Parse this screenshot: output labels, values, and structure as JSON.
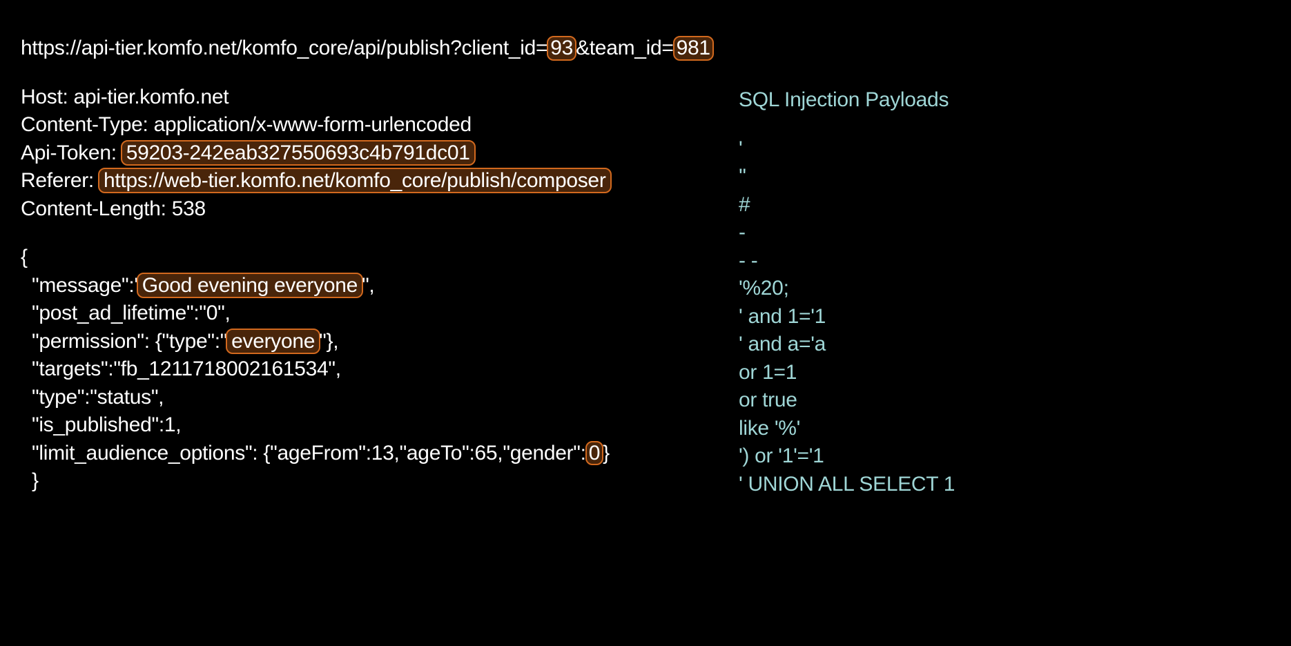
{
  "url": {
    "pre_client_id": "https://api-tier.komfo.net/komfo_core/api/publish?client_id=",
    "client_id": "93",
    "mid": "&team_id=",
    "team_id": "981"
  },
  "headers": {
    "host": "Host: api-tier.komfo.net",
    "content_type": "Content-Type: application/x-www-form-urlencoded",
    "api_token_label": "Api-Token: ",
    "api_token_value": "59203-242eab327550693c4b791dc01",
    "referer_label": "Referer: ",
    "referer_value": "https://web-tier.komfo.net/komfo_core/publish/composer",
    "content_length": "Content-Length: 538"
  },
  "body": {
    "open": "{",
    "message_pre": " \"message\":'",
    "message_val": "Good evening everyone",
    "message_post": "\",",
    "post_ad_lifetime": " \"post_ad_lifetime\":\"0\",",
    "permission_pre": " \"permission\": {\"type\":\"",
    "permission_val": "everyone",
    "permission_post": "\"},",
    "targets": " \"targets\":\"fb_1211718002161534\",",
    "type": " \"type\":\"status\",",
    "is_published": " \"is_published\":1,",
    "limit_pre": " \"limit_audience_options\": {\"ageFrom\":13,\"ageTo\":65,\"gender\":",
    "limit_val": "0",
    "limit_post": "}",
    "close": "}"
  },
  "sidebar": {
    "title": "SQL Injection Payloads",
    "items": [
      "'",
      "''",
      "#",
      "-",
      "- -",
      "'%20;",
      "' and 1='1",
      "' and a='a",
      " or 1=1",
      " or true",
      "like '%'",
      "') or '1'='1",
      "' UNION ALL SELECT 1"
    ]
  }
}
